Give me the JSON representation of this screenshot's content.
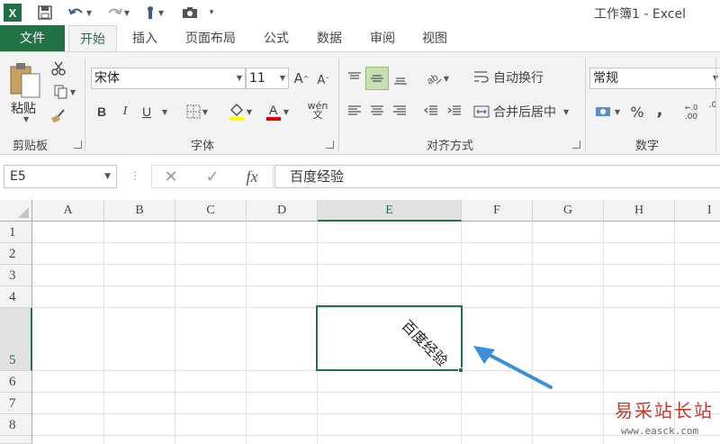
{
  "window": {
    "title": "工作簿1 - Excel",
    "logo": "X"
  },
  "qat": {
    "icons": [
      "save-icon",
      "undo-icon",
      "redo-icon",
      "touch-mode-icon",
      "camera-icon",
      "customize-qat-icon"
    ]
  },
  "tabs": [
    "文件",
    "开始",
    "插入",
    "页面布局",
    "公式",
    "数据",
    "审阅",
    "视图"
  ],
  "active_tab": "开始",
  "ribbon": {
    "clipboard": {
      "label": "剪贴板",
      "paste_label": "粘贴"
    },
    "font": {
      "label": "字体",
      "font_name": "宋体",
      "font_size": "11",
      "bold": "B",
      "italic": "I",
      "underline": "U",
      "phonetic": "wén"
    },
    "alignment": {
      "label": "对齐方式",
      "wrap_text": "自动换行",
      "merge_center": "合并后居中"
    },
    "number": {
      "label": "数字",
      "format": "常规",
      "percent": "%",
      "comma": ",",
      "inc_decimal": ".00",
      "dec_decimal": ".0"
    }
  },
  "formula_bar": {
    "name_box": "E5",
    "fx": "fx",
    "value": "百度经验"
  },
  "grid": {
    "columns": [
      "A",
      "B",
      "C",
      "D",
      "E",
      "F",
      "G",
      "H",
      "I"
    ],
    "rows": [
      "1",
      "2",
      "3",
      "4",
      "5",
      "6",
      "7",
      "8"
    ],
    "selected_cell": "E5",
    "cell_text": "百度经验",
    "text_rotation_deg": -45
  },
  "watermark": {
    "name": "易采站长站",
    "url": "www.easck.com"
  },
  "colors": {
    "accent": "#217346",
    "arrow": "#3a8fd6",
    "watermark": "#c0392b"
  }
}
